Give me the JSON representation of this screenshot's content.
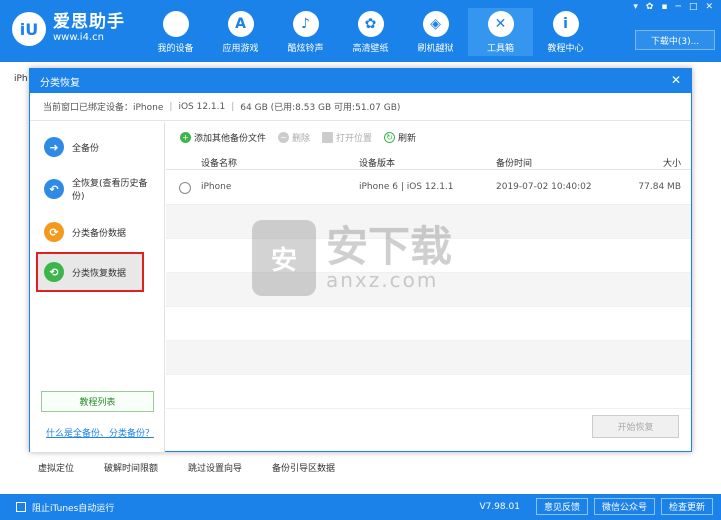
{
  "app": {
    "logo_mark": "iU",
    "name": "爱思助手",
    "url": "www.i4.cn"
  },
  "nav": [
    {
      "label": "我的设备",
      "icon": "apple-icon",
      "glyph": ""
    },
    {
      "label": "应用游戏",
      "icon": "app-store-icon",
      "glyph": "A"
    },
    {
      "label": "酷炫铃声",
      "icon": "bell-icon",
      "glyph": "♪"
    },
    {
      "label": "高清壁纸",
      "icon": "flower-icon",
      "glyph": "✿"
    },
    {
      "label": "刷机越狱",
      "icon": "box-icon",
      "glyph": "◈"
    },
    {
      "label": "工具箱",
      "icon": "tools-icon",
      "glyph": "✕"
    },
    {
      "label": "教程中心",
      "icon": "info-icon",
      "glyph": "i"
    }
  ],
  "window_controls": [
    "▾",
    "✿",
    "▪",
    "─",
    "□",
    "✕"
  ],
  "download_label": "下载中(3)...",
  "bg": {
    "tab_partial": "iPh",
    "tools": [
      "虚拟定位",
      "破解时间限额",
      "跳过设置向导",
      "备份引导区数据"
    ]
  },
  "statusbar": {
    "itunes_label": "阻止iTunes自动运行",
    "version": "V7.98.01",
    "buttons": [
      "意见反馈",
      "微信公众号",
      "检查更新"
    ]
  },
  "dialog": {
    "title": "分类恢复",
    "close": "✕",
    "device_prefix": "当前窗口已绑定设备：iPhone",
    "ios": "iOS 12.1.1",
    "storage": "64 GB (已用:8.53 GB 可用:51.07 GB)",
    "sidebar": [
      {
        "label": "全备份",
        "glyph": "➜",
        "color": "#2f8ae6"
      },
      {
        "label": "全恢复(查看历史备份)",
        "glyph": "↶",
        "color": "#2f8ae6"
      },
      {
        "label": "分类备份数据",
        "glyph": "⟳",
        "color": "#f39a1e"
      },
      {
        "label": "分类恢复数据",
        "glyph": "⟲",
        "color": "#3cb54a"
      }
    ],
    "tutorial_btn": "教程列表",
    "help_link": "什么是全备份、分类备份？",
    "toolbar": {
      "add": "添加其他备份文件",
      "delete": "删除",
      "open": "打开位置",
      "refresh": "刷新"
    },
    "columns": [
      "设备名称",
      "设备版本",
      "备份时间",
      "大小"
    ],
    "rows": [
      {
        "name": "iPhone",
        "version": "iPhone 6 | iOS 12.1.1",
        "time": "2019-07-02 10:40:02",
        "size": "77.84 MB"
      }
    ],
    "start_btn": "开始恢复"
  },
  "watermark": {
    "bag_glyph": "安",
    "big": "安下载",
    "small": "anxz.com"
  },
  "colors": {
    "brand": "#1a82e8",
    "highlight_border": "#e02020"
  }
}
